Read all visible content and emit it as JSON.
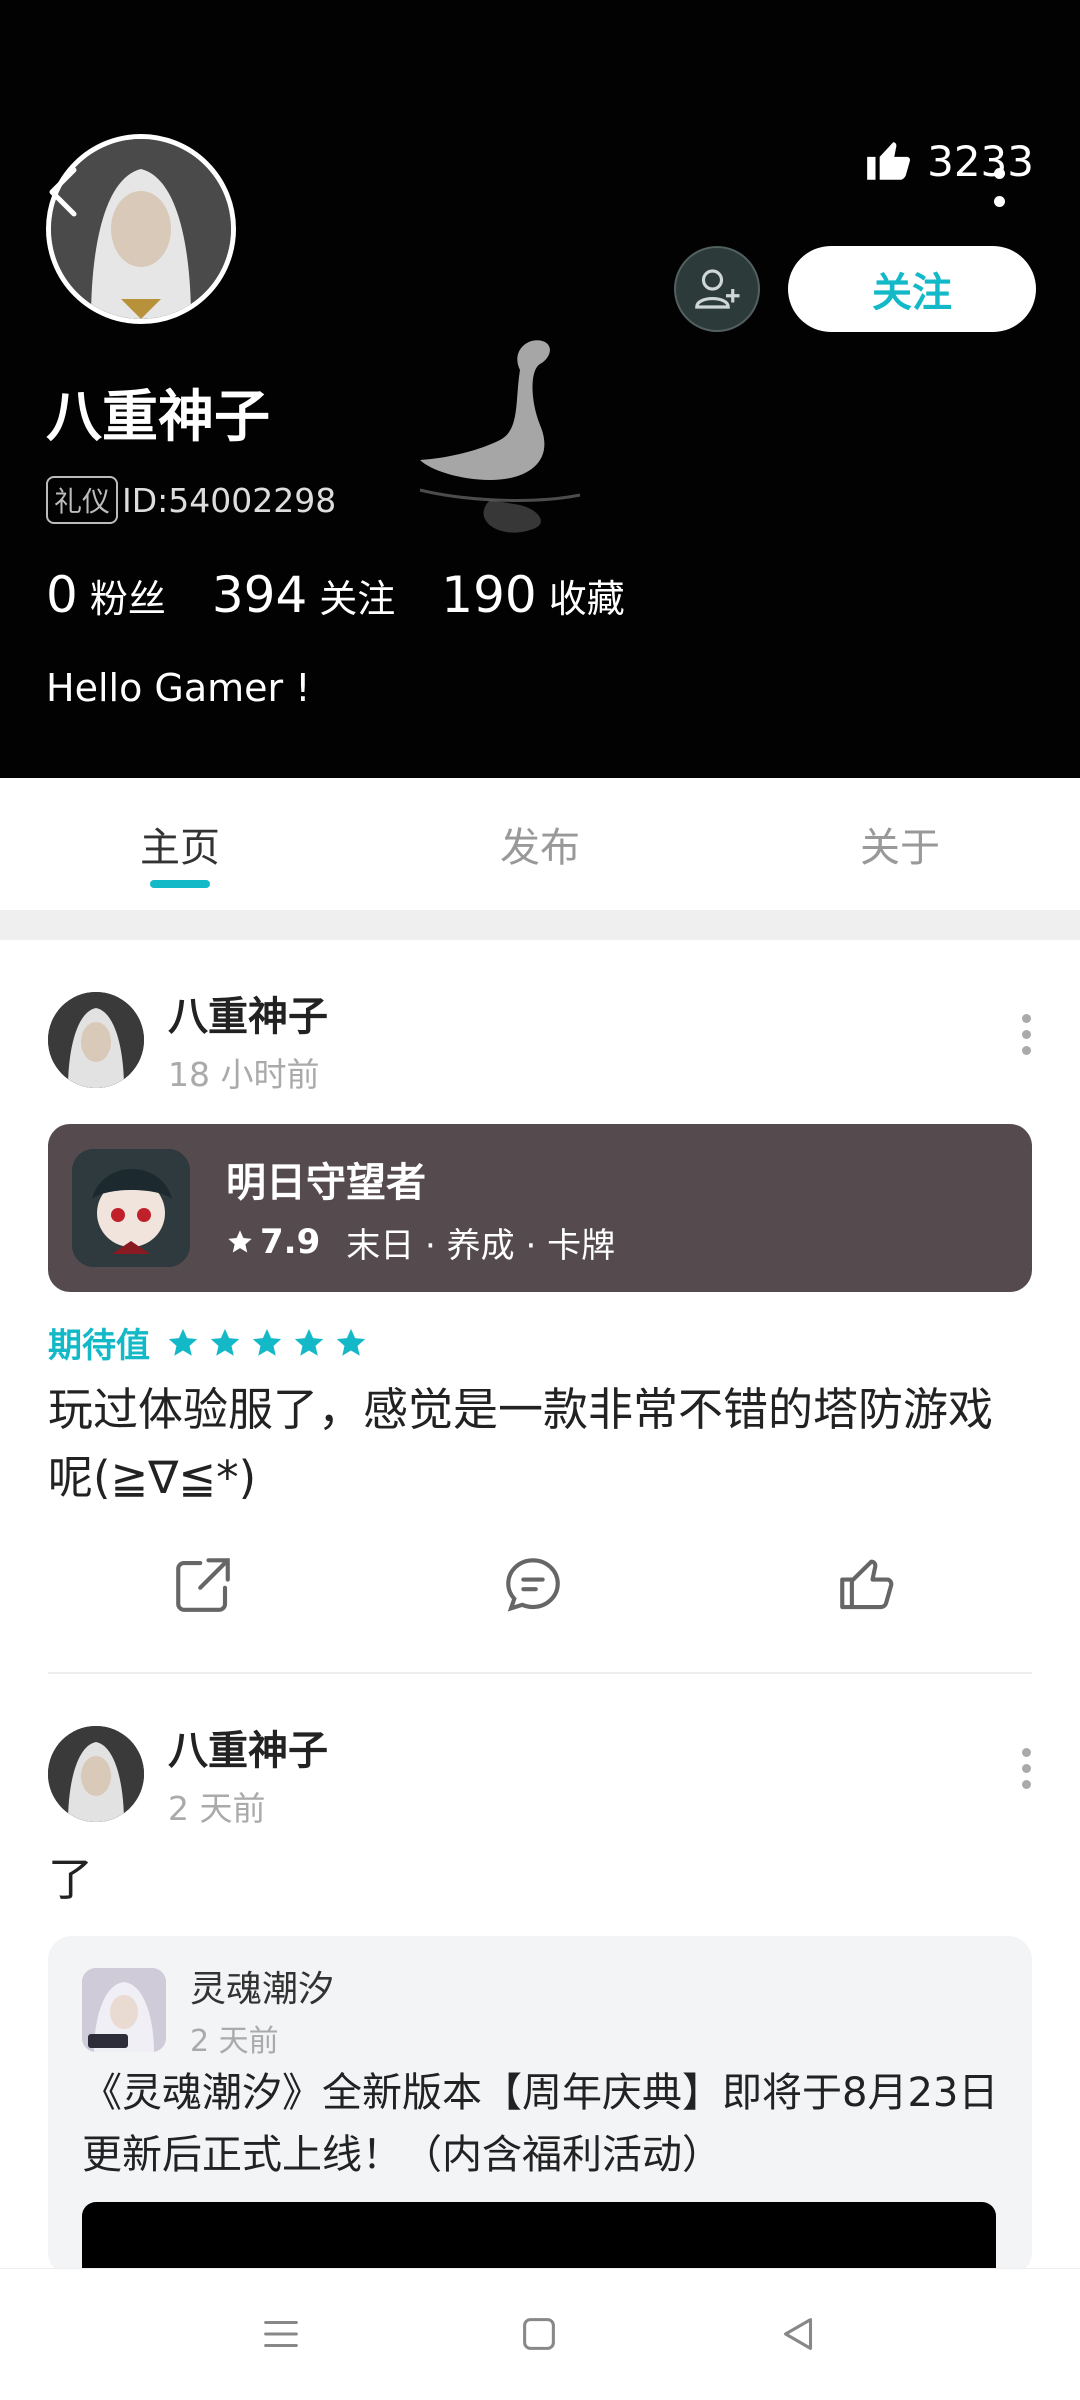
{
  "profile": {
    "name": "八重神子",
    "badge": "礼仪",
    "id_text": "ID:54002298",
    "likes": "3233",
    "follow_label": "关注",
    "bio": "Hello Gamer !",
    "stats": [
      {
        "value": "0",
        "label": "粉丝"
      },
      {
        "value": "394",
        "label": "关注"
      },
      {
        "value": "190",
        "label": "收藏"
      }
    ]
  },
  "tabs": [
    {
      "label": "主页",
      "active": true
    },
    {
      "label": "发布",
      "active": false
    },
    {
      "label": "关于",
      "active": false
    }
  ],
  "posts": [
    {
      "author": "八重神子",
      "time": "18 小时前",
      "game": {
        "name": "明日守望者",
        "score": "7.9",
        "tags": "末日 · 养成 · 卡牌"
      },
      "expect_label": "期待值",
      "stars": 5,
      "text": "玩过体验服了，感觉是一款非常不错的塔防游戏呢(≧∇≦*)"
    },
    {
      "author": "八重神子",
      "time": "2 天前",
      "text": "了",
      "shared": {
        "author": "灵魂潮汐",
        "time": "2 天前",
        "text": "《灵魂潮汐》全新版本【周年庆典】即将于8月23日更新后正式上线！（内含福利活动）"
      }
    }
  ],
  "colors": {
    "accent": "#14b9c8",
    "header_bg": "#020202",
    "game_card_bg": "#554b4f"
  }
}
